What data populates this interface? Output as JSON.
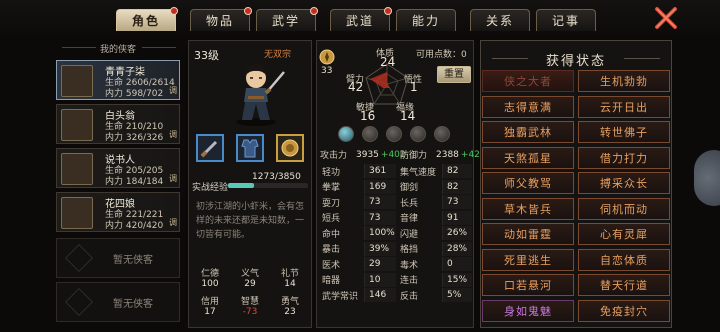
{
  "tabs": [
    {
      "label": "角色",
      "active": true,
      "dot": true
    },
    {
      "label": "物品",
      "active": false,
      "dot": true
    },
    {
      "label": "武学",
      "active": false,
      "dot": true
    },
    {
      "label": "武道",
      "active": false,
      "dot": true
    },
    {
      "label": "能力",
      "active": false,
      "dot": false
    },
    {
      "label": "关系",
      "active": false,
      "dot": false
    },
    {
      "label": "记事",
      "active": false,
      "dot": false
    }
  ],
  "sidebar": {
    "title": "我的侠客",
    "heroes": [
      {
        "name": "青青子柒",
        "hp": "生命 2606/2614",
        "mp": "内力 598/702",
        "tag": "调",
        "selected": true
      },
      {
        "name": "白头翁",
        "hp": "生命 210/210",
        "mp": "内力 326/326",
        "tag": "调",
        "selected": false
      },
      {
        "name": "说书人",
        "hp": "生命 205/205",
        "mp": "内力 184/184",
        "tag": "调",
        "selected": false
      },
      {
        "name": "花四娘",
        "hp": "生命 221/221",
        "mp": "内力 420/420",
        "tag": "调",
        "selected": false
      }
    ],
    "empty_label": "暂无侠客"
  },
  "character": {
    "level": "33级",
    "faction": "无双宗",
    "exp_label": "实战经验",
    "exp_text": "1273/3850",
    "exp_fraction": 0.33,
    "bio": "初涉江湖的小虾米，会有怎样的未来还都是未知数，一切皆有可能。",
    "virtues": [
      {
        "k": "仁德",
        "v": "100"
      },
      {
        "k": "义气",
        "v": "29"
      },
      {
        "k": "礼节",
        "v": "14"
      },
      {
        "k": "信用",
        "v": "17"
      },
      {
        "k": "智慧",
        "v": "-73"
      },
      {
        "k": "勇气",
        "v": "23"
      }
    ]
  },
  "attributes": {
    "free_points_label": "可用点数：",
    "free_points": "0",
    "rank_value": "33",
    "reset_label": "重置",
    "tizhi": {
      "k": "体质",
      "v": "24"
    },
    "bili": {
      "k": "臂力",
      "v": "42"
    },
    "wuxing": {
      "k": "悟性",
      "v": "1"
    },
    "minjie": {
      "k": "敏捷",
      "v": "16"
    },
    "fuyuan": {
      "k": "福缘",
      "v": "14"
    }
  },
  "combat": {
    "atk": {
      "k": "攻击力",
      "v": "3935",
      "bonus": "+402"
    },
    "def": {
      "k": "防御力",
      "v": "2388",
      "bonus": "+429"
    }
  },
  "stats_left": [
    {
      "k": "轻功",
      "v": "361"
    },
    {
      "k": "拳掌",
      "v": "169"
    },
    {
      "k": "耍刀",
      "v": "73"
    },
    {
      "k": "短兵",
      "v": "73"
    },
    {
      "k": "命中",
      "v": "100%"
    },
    {
      "k": "暴击",
      "v": "39%"
    },
    {
      "k": "医术",
      "v": "29"
    },
    {
      "k": "暗器",
      "v": "10"
    },
    {
      "k": "武学常识",
      "v": "146"
    }
  ],
  "stats_right": [
    {
      "k": "集气速度",
      "v": "82"
    },
    {
      "k": "御剑",
      "v": "82"
    },
    {
      "k": "长兵",
      "v": "73"
    },
    {
      "k": "音律",
      "v": "91"
    },
    {
      "k": "闪避",
      "v": "26%"
    },
    {
      "k": "格挡",
      "v": "28%"
    },
    {
      "k": "毒术",
      "v": "0"
    },
    {
      "k": "连击",
      "v": "15%"
    },
    {
      "k": "反击",
      "v": "5%"
    }
  ],
  "status": {
    "title": "获得状态",
    "buffs": [
      {
        "label": "侠之大者",
        "style": "gray"
      },
      {
        "label": "生机勃勃",
        "style": "normal"
      },
      {
        "label": "志得意满",
        "style": "normal"
      },
      {
        "label": "云开日出",
        "style": "normal"
      },
      {
        "label": "独霸武林",
        "style": "normal"
      },
      {
        "label": "转世佛子",
        "style": "normal"
      },
      {
        "label": "天煞孤星",
        "style": "normal"
      },
      {
        "label": "借力打力",
        "style": "normal"
      },
      {
        "label": "师父教骂",
        "style": "normal"
      },
      {
        "label": "搏采众长",
        "style": "normal"
      },
      {
        "label": "草木皆兵",
        "style": "normal"
      },
      {
        "label": "伺机而动",
        "style": "normal"
      },
      {
        "label": "动如雷霆",
        "style": "normal"
      },
      {
        "label": "心有灵犀",
        "style": "normal"
      },
      {
        "label": "死里逃生",
        "style": "normal"
      },
      {
        "label": "自恋体质",
        "style": "normal"
      },
      {
        "label": "口若悬河",
        "style": "normal"
      },
      {
        "label": "替天行道",
        "style": "normal"
      },
      {
        "label": "身如鬼魅",
        "style": "purple"
      },
      {
        "label": "免疫封穴",
        "style": "normal"
      }
    ]
  }
}
